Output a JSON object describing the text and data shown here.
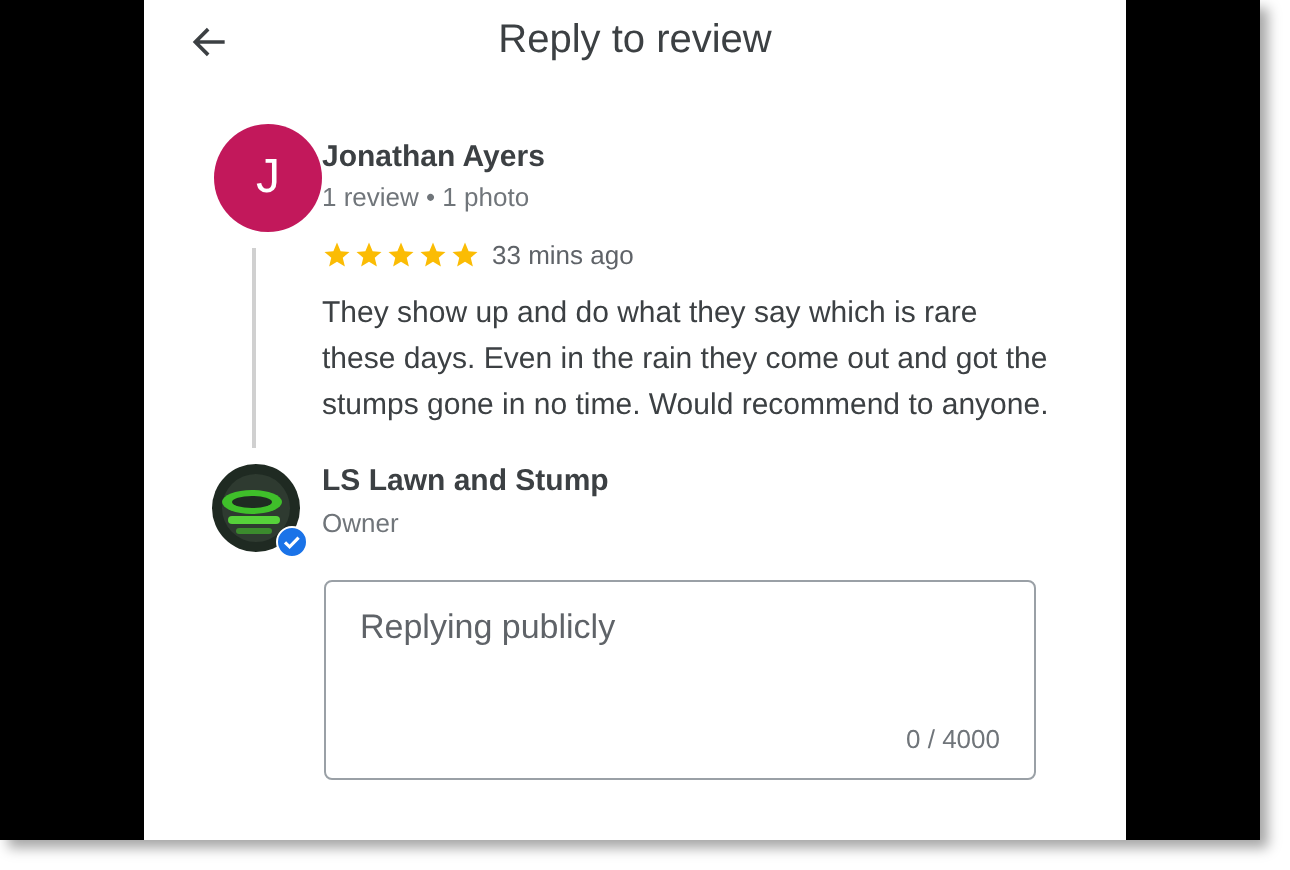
{
  "header": {
    "title": "Reply to review"
  },
  "review": {
    "avatar_letter": "J",
    "author": "Jonathan Ayers",
    "meta": "1 review • 1 photo",
    "stars": 5,
    "time": "33 mins ago",
    "text": "They show up and do what they say which is rare these days. Even in the rain they come out and got the stumps gone in no time. Would recommend to anyone."
  },
  "owner": {
    "name": "LS Lawn and Stump",
    "role": "Owner",
    "verified": true
  },
  "reply_field": {
    "placeholder": "Replying publicly",
    "counter": "0 / 4000"
  }
}
